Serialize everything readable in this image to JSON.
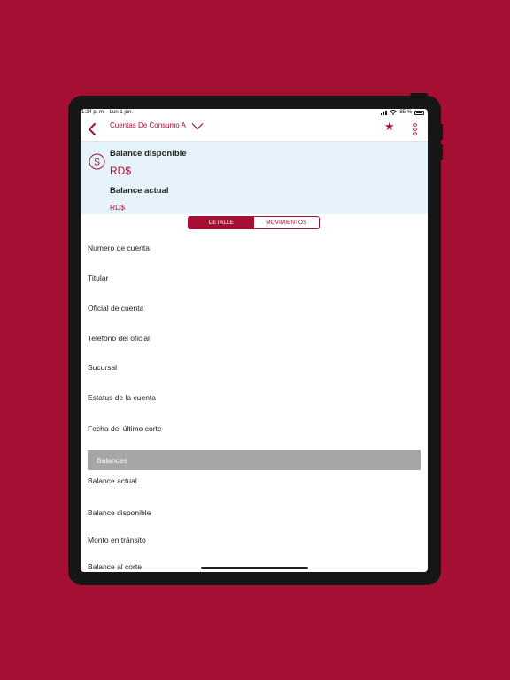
{
  "status_bar": {
    "time": "1:34 p. m.",
    "date": "Lun 1 jun.",
    "battery": "85 %"
  },
  "nav": {
    "title": "Cuentas De Consumo A",
    "back_icon": "chevron-left-icon",
    "dropdown_icon": "chevron-down-icon",
    "favorite_icon": "star-icon",
    "more_icon": "more-vertical-icon"
  },
  "balance": {
    "icon": "dollar-circle-icon",
    "available_label": "Balance disponible",
    "available_amount": "RD$",
    "current_label": "Balance actual",
    "current_amount": "RD$"
  },
  "tabs": [
    {
      "label": "DETALLE",
      "active": true
    },
    {
      "label": "MOVIMIENTOS",
      "active": false
    }
  ],
  "details": [
    "Numero de cuenta",
    "Titular",
    "Oficial de cuenta",
    "Teléfono del oficial",
    "Sucursal",
    "Estatus de la cuenta",
    "Fecha del último corte"
  ],
  "balances_section": {
    "header": "Balances",
    "items": [
      "Balance actual",
      "Balance disponible",
      "Monto en tránsito",
      "Balance al corte"
    ]
  },
  "colors": {
    "brand": "#a50f33",
    "balance_bg": "#e6f3fa",
    "section_bg": "#a6a6a6"
  }
}
